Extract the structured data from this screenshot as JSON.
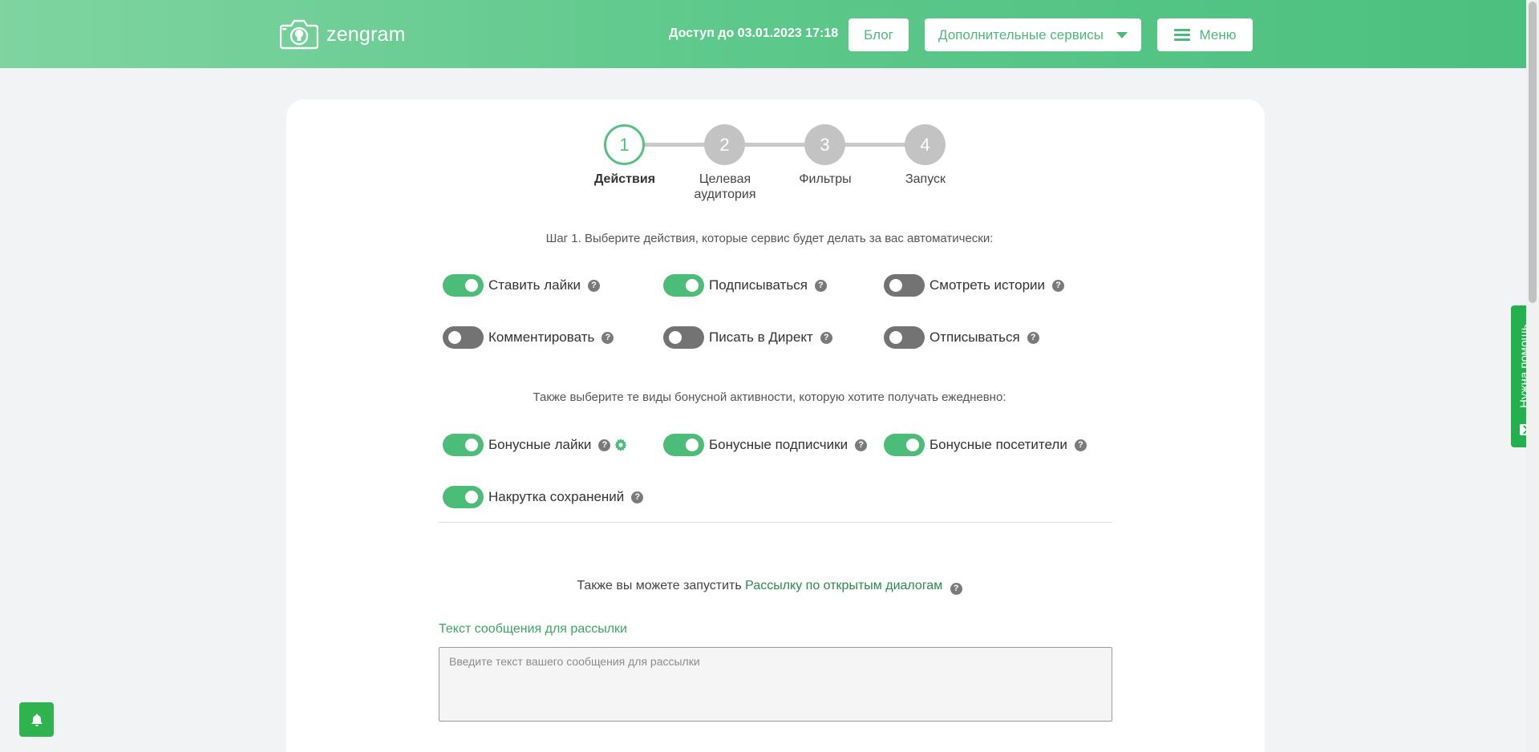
{
  "header": {
    "logo_text": "zengram",
    "access": "Доступ до 03.01.2023 17:18",
    "blog_label": "Блог",
    "services_label": "Дополнительные сервисы",
    "menu_label": "Меню"
  },
  "steps": [
    {
      "number": "1",
      "label": "Действия",
      "active": true
    },
    {
      "number": "2",
      "label": "Целевая аудитория",
      "active": false
    },
    {
      "number": "3",
      "label": "Фильтры",
      "active": false
    },
    {
      "number": "4",
      "label": "Запуск",
      "active": false
    }
  ],
  "step1_caption": "Шаг 1. Выберите действия, которые сервис будет делать за вас автоматически:",
  "actions": [
    {
      "label": "Ставить лайки",
      "on": true
    },
    {
      "label": "Подписываться",
      "on": true
    },
    {
      "label": "Смотреть истории",
      "on": false
    },
    {
      "label": "Комментировать",
      "on": false
    },
    {
      "label": "Писать в Директ",
      "on": false
    },
    {
      "label": "Отписываться",
      "on": false
    }
  ],
  "bonus_caption": "Также выберите те виды бонусной активности, которую хотите получать ежедневно:",
  "bonuses": [
    {
      "label": "Бонусные лайки",
      "on": true
    },
    {
      "label": "Бонусные подписчики",
      "on": true
    },
    {
      "label": "Бонусные посетители",
      "on": true
    },
    {
      "label": "Накрутка сохранений",
      "on": true
    }
  ],
  "help_glyph": "?",
  "mailing": {
    "prefix": "Также вы можете запустить",
    "link": "Рассылку по открытым диалогам",
    "message_label": "Текст сообщения для рассылки",
    "placeholder": "Введите текст вашего сообщения для рассылки"
  },
  "side_help": "Нужна помощь",
  "colors": {
    "accent": "#4cbd78",
    "toggle_off": "#737373",
    "header_gradient_start": "#7fd4a0",
    "header_gradient_end": "#4cc07f"
  }
}
